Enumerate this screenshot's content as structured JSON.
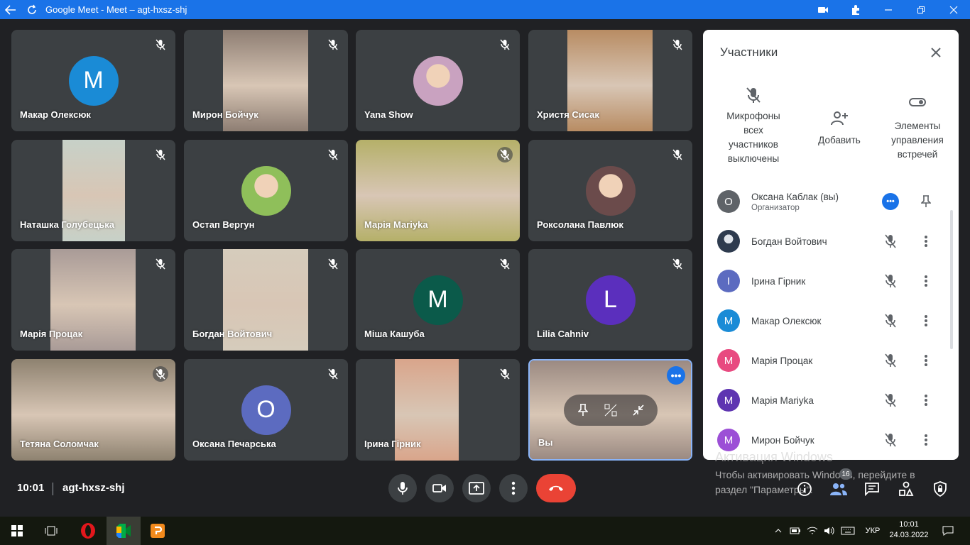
{
  "window": {
    "title": "Google Meet - Meet – agt-hxsz-shj",
    "back_icon": "arrow-left-icon",
    "reload_icon": "reload-icon"
  },
  "tiles": [
    {
      "name": "Макар Олексюк",
      "type": "letter",
      "letter": "M",
      "color": "#1a8bd6"
    },
    {
      "name": "Мирон Бойчук",
      "type": "video",
      "color": "#8e7e73"
    },
    {
      "name": "Yana Show",
      "type": "photo",
      "color": "#c9a2c0"
    },
    {
      "name": "Христя Сисак",
      "type": "video",
      "color": "#b88c63"
    },
    {
      "name": "Наташка Голубецька",
      "type": "video",
      "color": "#c7d1c8"
    },
    {
      "name": "Остап Вергун",
      "type": "photo",
      "color": "#8fbf5a"
    },
    {
      "name": "Марія Маriyka",
      "type": "video",
      "color": "#b5b069"
    },
    {
      "name": "Роксолана Павлюк",
      "type": "photo",
      "color": "#6b4b4b"
    },
    {
      "name": "Марія Процак",
      "type": "video",
      "color": "#a99b97"
    },
    {
      "name": "Богдан Войтович",
      "type": "video",
      "color": "#d6ccbc"
    },
    {
      "name": "Міша Кашуба",
      "type": "letter",
      "letter": "M",
      "color": "#0b5a4a"
    },
    {
      "name": "Lilia Cahniv",
      "type": "letter",
      "letter": "L",
      "color": "#5b2fbd"
    },
    {
      "name": "Тетяна Соломчак",
      "type": "video",
      "color": "#8e8270"
    },
    {
      "name": "Оксана Печарська",
      "type": "letter",
      "letter": "O",
      "color": "#5c6bc0"
    },
    {
      "name": "Ірина Гірник",
      "type": "video",
      "color": "#d9a58b"
    },
    {
      "name": "Вы",
      "type": "self",
      "color": "#9b8a82"
    }
  ],
  "panel": {
    "title": "Участники",
    "actions": [
      {
        "label": "Микрофоны всех участников выключены",
        "icon": "mic-off-icon"
      },
      {
        "label": "Добавить",
        "icon": "add-person-icon"
      },
      {
        "label": "Элементы управления встречей",
        "icon": "toggle-icon"
      }
    ],
    "participants": [
      {
        "name": "Оксана Каблак (вы)",
        "role": "Организатор",
        "letter": "О",
        "color": "#5f6368",
        "is_self": true
      },
      {
        "name": "Богдан Войтович",
        "letter": "",
        "color": "#2e3b4e",
        "is_photo": true
      },
      {
        "name": "Ірина Гірник",
        "letter": "I",
        "color": "#5c6bc0"
      },
      {
        "name": "Макар Олексюк",
        "letter": "M",
        "color": "#1a8bd6"
      },
      {
        "name": "Марія Процак",
        "letter": "M",
        "color": "#e84a80"
      },
      {
        "name": "Марія Маriyka",
        "letter": "M",
        "color": "#5e35b1"
      },
      {
        "name": "Мирон Бойчук",
        "letter": "M",
        "color": "#9c4fd6"
      }
    ]
  },
  "watermark": {
    "line1": "Активация Windows",
    "line2": "Чтобы активировать Windows, перейдите в",
    "line3": "раздел \"Параметры\"."
  },
  "bottom": {
    "time": "10:01",
    "code": "agt-hxsz-shj",
    "participant_count": "16"
  },
  "taskbar": {
    "lang": "УКР",
    "time": "10:01",
    "date": "24.03.2022"
  }
}
